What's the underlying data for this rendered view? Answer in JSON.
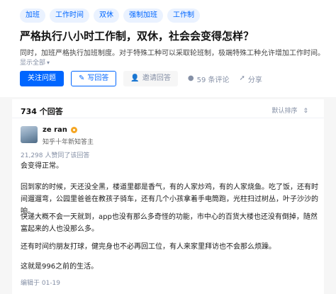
{
  "tags": [
    "加班",
    "工作时间",
    "双休",
    "强制加班",
    "工作制"
  ],
  "question": {
    "title": "严格执行八小时工作制，双休，社会会变得怎样？",
    "excerpt": "同时，加班严格执行加班制度。对于特殊工种可以采取轮班制，极端特殊工种允许增加工作时间。",
    "show_all": "显示全部",
    "show_all_icon": "chevron-down-icon"
  },
  "actions": {
    "follow": "关注问题",
    "write": "写回答",
    "invite": "邀请回答",
    "comments": "59 条评论",
    "share": "分享"
  },
  "answers": {
    "count_label": "734 个回答",
    "sort_label": "默认排序"
  },
  "answer": {
    "author": "ze ran",
    "bio": "知乎十年新知答主",
    "votes": "21,298 人赞同了该回答",
    "paragraphs": [
      "会变得正常。",
      "回到家的时候，天还没全黑，楼道里都是香气，有的人家炒鸡，有的人家烧鱼。吃了饭，还有时间遛遛弯，公园里爸爸在教孩子骑车，还有几个小孩拿着手电筒跑，光柱扫过树丛，叶子沙沙的响。",
      "快递大概不会一天就到，app也没有那么多奇怪的功能，市中心的百货大楼也还没有倒掉，随然富起来的人也没那么多。",
      "还有时间约朋友打球，健完身也不必再回工位，有人来家里拜访也不会那么烦躁。",
      "这就是996之前的生活。"
    ],
    "edited": "编辑于 01-19"
  },
  "colors": {
    "brand": "#0066ff",
    "muted": "#8590a6",
    "badge": "#f5a623"
  }
}
